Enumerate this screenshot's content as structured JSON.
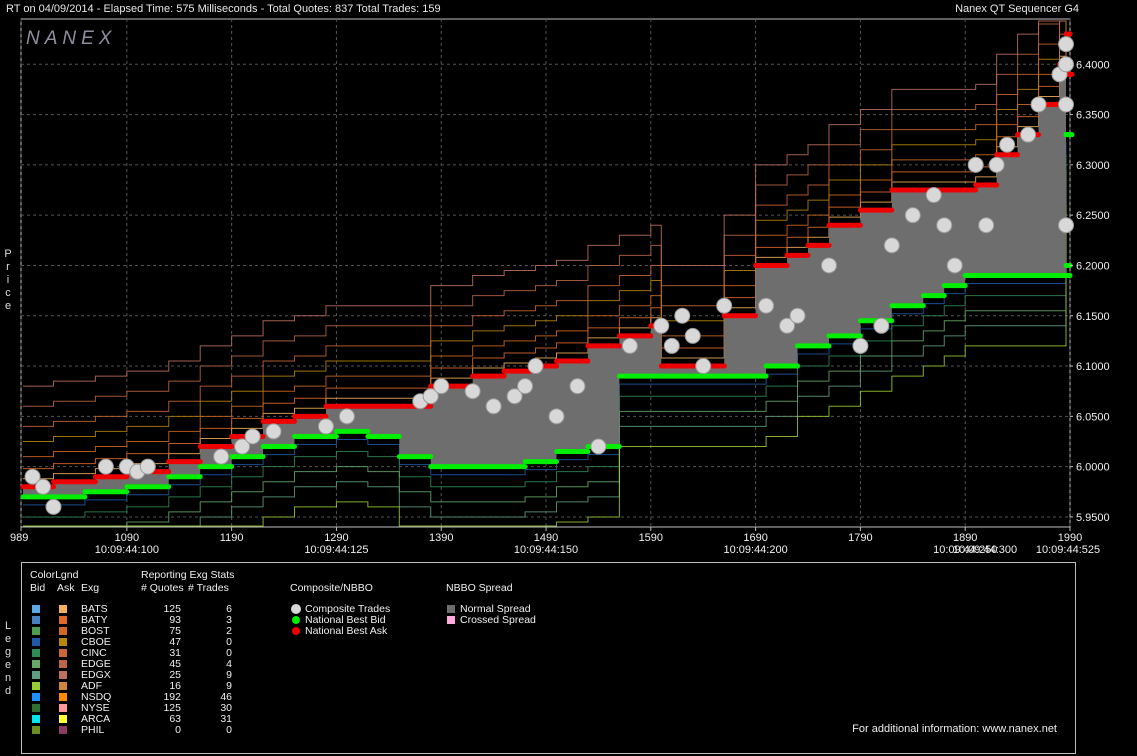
{
  "header": {
    "left": "RT on 04/09/2014  -  Elapsed Time: 575 Milliseconds  -  Total Quotes: 837  Total Trades: 159",
    "right": "Nanex QT Sequencer G4"
  },
  "logo_text": "NANEX",
  "side_labels": {
    "price": "Price",
    "legend": "Legend"
  },
  "chart_data": {
    "type": "line",
    "y_ticks": [
      "6.4000",
      "6.3500",
      "6.3000",
      "6.2500",
      "6.2000",
      "6.1500",
      "6.1000",
      "6.0500",
      "6.0000",
      "5.9500"
    ],
    "ylim": [
      5.94,
      6.445
    ],
    "xlim": [
      989,
      1990
    ],
    "x_ticks": [
      "989",
      "1090",
      "1190",
      "1290",
      "1390",
      "1490",
      "1590",
      "1690",
      "1790",
      "1890",
      "1990"
    ],
    "time_labels": [
      {
        "seq": 1090,
        "label": "10:09:44:100"
      },
      {
        "seq": 1290,
        "label": "10:09:44:125"
      },
      {
        "seq": 1490,
        "label": "10:09:44:150"
      },
      {
        "seq": 1690,
        "label": "10:09:44:200"
      },
      {
        "seq": 1890,
        "label": "10:09:44:250"
      },
      {
        "seq": 1990,
        "label": "10:09:44:300"
      },
      {
        "seq": 1990,
        "label": "10:09:44:525"
      }
    ],
    "nbbo_bid": [
      [
        989,
        5.97
      ],
      [
        1020,
        5.97
      ],
      [
        1050,
        5.975
      ],
      [
        1090,
        5.98
      ],
      [
        1130,
        5.99
      ],
      [
        1160,
        6.0
      ],
      [
        1190,
        6.01
      ],
      [
        1220,
        6.02
      ],
      [
        1250,
        6.03
      ],
      [
        1290,
        6.035
      ],
      [
        1320,
        6.03
      ],
      [
        1350,
        6.01
      ],
      [
        1380,
        6.0
      ],
      [
        1440,
        6.0
      ],
      [
        1470,
        6.005
      ],
      [
        1500,
        6.015
      ],
      [
        1530,
        6.02
      ],
      [
        1560,
        6.09
      ],
      [
        1620,
        6.09
      ],
      [
        1680,
        6.09
      ],
      [
        1700,
        6.1
      ],
      [
        1730,
        6.12
      ],
      [
        1760,
        6.13
      ],
      [
        1790,
        6.145
      ],
      [
        1820,
        6.16
      ],
      [
        1850,
        6.17
      ],
      [
        1870,
        6.18
      ],
      [
        1890,
        6.19
      ],
      [
        1990,
        6.19
      ],
      [
        2010,
        6.2
      ],
      [
        2030,
        6.33
      ],
      [
        2080,
        6.33
      ]
    ],
    "nbbo_ask": [
      [
        989,
        5.98
      ],
      [
        1020,
        5.985
      ],
      [
        1060,
        5.99
      ],
      [
        1090,
        5.995
      ],
      [
        1130,
        6.005
      ],
      [
        1160,
        6.02
      ],
      [
        1190,
        6.03
      ],
      [
        1220,
        6.045
      ],
      [
        1250,
        6.05
      ],
      [
        1280,
        6.06
      ],
      [
        1320,
        6.06
      ],
      [
        1350,
        6.06
      ],
      [
        1380,
        6.08
      ],
      [
        1420,
        6.09
      ],
      [
        1450,
        6.095
      ],
      [
        1480,
        6.1
      ],
      [
        1500,
        6.105
      ],
      [
        1530,
        6.12
      ],
      [
        1560,
        6.13
      ],
      [
        1590,
        6.14
      ],
      [
        1600,
        6.1
      ],
      [
        1640,
        6.1
      ],
      [
        1660,
        6.15
      ],
      [
        1690,
        6.2
      ],
      [
        1720,
        6.21
      ],
      [
        1740,
        6.22
      ],
      [
        1760,
        6.24
      ],
      [
        1790,
        6.255
      ],
      [
        1820,
        6.275
      ],
      [
        1840,
        6.275
      ],
      [
        1880,
        6.275
      ],
      [
        1900,
        6.28
      ],
      [
        1920,
        6.31
      ],
      [
        1940,
        6.33
      ],
      [
        1960,
        6.36
      ],
      [
        1980,
        6.4
      ],
      [
        2000,
        6.43
      ],
      [
        2040,
        6.43
      ],
      [
        2060,
        6.39
      ],
      [
        2080,
        6.39
      ]
    ],
    "trades": [
      [
        1000,
        5.99
      ],
      [
        1010,
        5.98
      ],
      [
        1020,
        5.96
      ],
      [
        1070,
        6.0
      ],
      [
        1090,
        6.0
      ],
      [
        1100,
        5.995
      ],
      [
        1110,
        6.0
      ],
      [
        1180,
        6.01
      ],
      [
        1200,
        6.02
      ],
      [
        1210,
        6.03
      ],
      [
        1230,
        6.035
      ],
      [
        1280,
        6.04
      ],
      [
        1300,
        6.05
      ],
      [
        1370,
        6.065
      ],
      [
        1380,
        6.07
      ],
      [
        1390,
        6.08
      ],
      [
        1420,
        6.075
      ],
      [
        1440,
        6.06
      ],
      [
        1460,
        6.07
      ],
      [
        1470,
        6.08
      ],
      [
        1480,
        6.1
      ],
      [
        1500,
        6.05
      ],
      [
        1520,
        6.08
      ],
      [
        1540,
        6.02
      ],
      [
        1570,
        6.12
      ],
      [
        1600,
        6.14
      ],
      [
        1610,
        6.12
      ],
      [
        1620,
        6.15
      ],
      [
        1630,
        6.13
      ],
      [
        1640,
        6.1
      ],
      [
        1660,
        6.16
      ],
      [
        1700,
        6.16
      ],
      [
        1720,
        6.14
      ],
      [
        1730,
        6.15
      ],
      [
        1760,
        6.2
      ],
      [
        1790,
        6.12
      ],
      [
        1810,
        6.14
      ],
      [
        1820,
        6.22
      ],
      [
        1840,
        6.25
      ],
      [
        1860,
        6.27
      ],
      [
        1870,
        6.24
      ],
      [
        1880,
        6.2
      ],
      [
        1900,
        6.3
      ],
      [
        1910,
        6.24
      ],
      [
        1920,
        6.3
      ],
      [
        1930,
        6.32
      ],
      [
        1950,
        6.33
      ],
      [
        1960,
        6.36
      ],
      [
        1980,
        6.39
      ],
      [
        2000,
        6.42
      ],
      [
        2010,
        6.4
      ],
      [
        2020,
        6.24
      ],
      [
        2060,
        6.36
      ]
    ]
  },
  "legend": {
    "headers": {
      "colorlgnd": "ColorLgnd",
      "bid": "Bid",
      "ask": "Ask",
      "exg": "Exg",
      "reporting": "Reporting Exg Stats",
      "quotes": "# Quotes",
      "trades": "# Trades",
      "composite": "Composite/NBBO",
      "spread": "NBBO Spread"
    },
    "exchanges": [
      {
        "name": "BATS",
        "quotes": "125",
        "trades": "6",
        "bid": "#5aa9e6",
        "ask": "#f4b05a"
      },
      {
        "name": "BATY",
        "quotes": "93",
        "trades": "3",
        "bid": "#4a7fbf",
        "ask": "#e06a2a"
      },
      {
        "name": "BOST",
        "quotes": "75",
        "trades": "2",
        "bid": "#4f9d4f",
        "ask": "#d2691e"
      },
      {
        "name": "CBOE",
        "quotes": "47",
        "trades": "0",
        "bid": "#1e5aa8",
        "ask": "#b8860b"
      },
      {
        "name": "CINC",
        "quotes": "31",
        "trades": "0",
        "bid": "#2e8b57",
        "ask": "#cc6633"
      },
      {
        "name": "EDGE",
        "quotes": "45",
        "trades": "4",
        "bid": "#66aa66",
        "ask": "#bb6644"
      },
      {
        "name": "EDGX",
        "quotes": "25",
        "trades": "9",
        "bid": "#5f9f7f",
        "ask": "#c07060"
      },
      {
        "name": "ADF",
        "quotes": "16",
        "trades": "9",
        "bid": "#9acd32",
        "ask": "#cd853f"
      },
      {
        "name": "NSDQ",
        "quotes": "192",
        "trades": "46",
        "bid": "#1e90ff",
        "ask": "#ff8c00"
      },
      {
        "name": "NYSE",
        "quotes": "125",
        "trades": "30",
        "bid": "#2f6f2f",
        "ask": "#ff9999"
      },
      {
        "name": "ARCA",
        "quotes": "63",
        "trades": "31",
        "bid": "#00e5ee",
        "ask": "#ffff33"
      },
      {
        "name": "PHIL",
        "quotes": "0",
        "trades": "0",
        "bid": "#6b8e23",
        "ask": "#8b3a62"
      }
    ],
    "composite_items": [
      {
        "label": "Composite Trades",
        "color": "#d8d8d8"
      },
      {
        "label": "National Best Bid",
        "color": "#00ee00"
      },
      {
        "label": "National Best Ask",
        "color": "#ee0000"
      }
    ],
    "spread_items": [
      {
        "label": "Normal Spread",
        "color": "#6e6e6e"
      },
      {
        "label": "Crossed Spread",
        "color": "#ffaadd"
      }
    ],
    "info": "For additional information: www.nanex.net"
  }
}
